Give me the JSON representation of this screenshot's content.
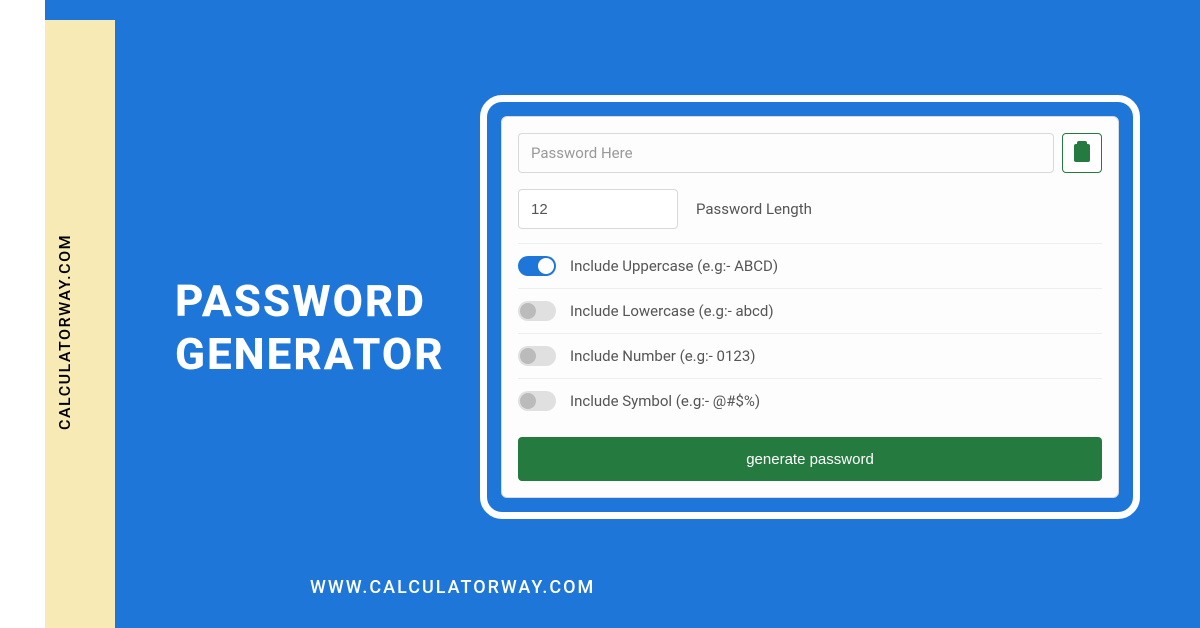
{
  "side_text": "CALCULATORWAY.COM",
  "title_line1": "PASSWORD",
  "title_line2": "GENERATOR",
  "footer_url": "WWW.CALCULATORWAY.COM",
  "widget": {
    "password_placeholder": "Password Here",
    "length_value": "12",
    "length_label": "Password Length",
    "options": [
      {
        "label": "Include Uppercase (e.g:- ABCD)",
        "on": true
      },
      {
        "label": "Include Lowercase (e.g:- abcd)",
        "on": false
      },
      {
        "label": "Include Number (e.g:- 0123)",
        "on": false
      },
      {
        "label": "Include Symbol (e.g:- @#$%)",
        "on": false
      }
    ],
    "generate_label": "generate password"
  }
}
